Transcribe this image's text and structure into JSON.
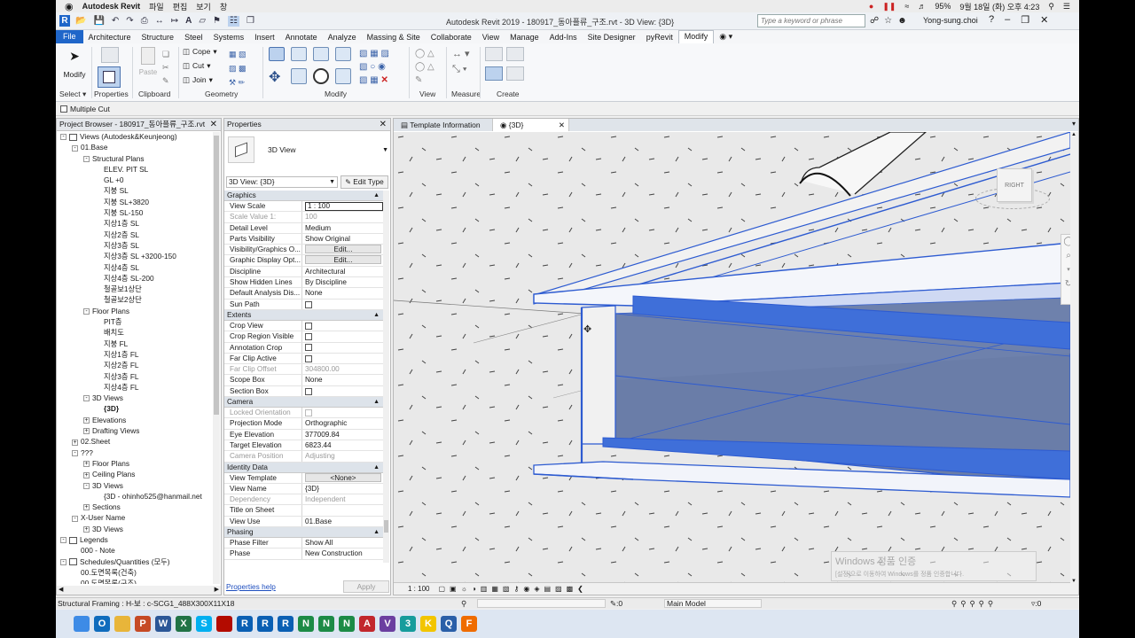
{
  "mac_menubar": {
    "app_name": "Autodesk Revit",
    "menus": [
      "파일",
      "편집",
      "보기",
      "창"
    ],
    "battery": "95%",
    "datetime": "9월 18일 (화) 오후 4:23"
  },
  "title_bar": {
    "title": "Autodesk Revit 2019 - 180917_동아플류_구조.rvt - 3D View: {3D}",
    "search_placeholder": "Type a keyword or phrase",
    "user": "Yong-sung.choi"
  },
  "ribbon_tabs": [
    "File",
    "Architecture",
    "Structure",
    "Steel",
    "Systems",
    "Insert",
    "Annotate",
    "Analyze",
    "Massing & Site",
    "Collaborate",
    "View",
    "Manage",
    "Add-Ins",
    "Site Designer",
    "pyRevit",
    "Modify"
  ],
  "ribbon_active_tab": "Modify",
  "ribbon_groups": {
    "select": "Select",
    "properties": "Properties",
    "clipboard": "Clipboard",
    "geometry": "Geometry",
    "modify": "Modify",
    "view": "View",
    "measure": "Measure",
    "create": "Create"
  },
  "ribbon_buttons": {
    "modify": "Modify",
    "paste": "Paste",
    "cope": "Cope",
    "cut": "Cut",
    "join": "Join"
  },
  "options_bar": {
    "multiple_cut": "Multiple Cut"
  },
  "project_browser": {
    "title": "Project Browser - 180917_동아플류_구조.rvt",
    "items": [
      {
        "label": "Views (Autodesk&Keunjeong)",
        "level": 0,
        "exp": "-"
      },
      {
        "label": "01.Base",
        "level": 1,
        "exp": "-"
      },
      {
        "label": "Structural Plans",
        "level": 2,
        "exp": "-"
      },
      {
        "label": "ELEV. PIT SL",
        "level": 3
      },
      {
        "label": "GL +0",
        "level": 3
      },
      {
        "label": "지붕 SL",
        "level": 3
      },
      {
        "label": "지붕 SL+3820",
        "level": 3
      },
      {
        "label": "지붕 SL-150",
        "level": 3
      },
      {
        "label": "지상1층 SL",
        "level": 3
      },
      {
        "label": "지상2층 SL",
        "level": 3
      },
      {
        "label": "지상3층 SL",
        "level": 3
      },
      {
        "label": "지상3층 SL +3200-150",
        "level": 3
      },
      {
        "label": "지상4층 SL",
        "level": 3
      },
      {
        "label": "지상4층 SL-200",
        "level": 3
      },
      {
        "label": "철골보1상단",
        "level": 3
      },
      {
        "label": "철골보2상단",
        "level": 3
      },
      {
        "label": "Floor Plans",
        "level": 2,
        "exp": "-"
      },
      {
        "label": "PIT층",
        "level": 3
      },
      {
        "label": "배치도",
        "level": 3
      },
      {
        "label": "지붕 FL",
        "level": 3
      },
      {
        "label": "지상1층 FL",
        "level": 3
      },
      {
        "label": "지상2층 FL",
        "level": 3
      },
      {
        "label": "지상3층 FL",
        "level": 3
      },
      {
        "label": "지상4층 FL",
        "level": 3
      },
      {
        "label": "3D Views",
        "level": 2,
        "exp": "-"
      },
      {
        "label": "{3D}",
        "level": 3,
        "bold": true
      },
      {
        "label": "Elevations",
        "level": 2,
        "exp": "+"
      },
      {
        "label": "Drafting Views",
        "level": 2,
        "exp": "+"
      },
      {
        "label": "02.Sheet",
        "level": 1,
        "exp": "+"
      },
      {
        "label": "???",
        "level": 1,
        "exp": "-"
      },
      {
        "label": "Floor Plans",
        "level": 2,
        "exp": "+"
      },
      {
        "label": "Ceiling Plans",
        "level": 2,
        "exp": "+"
      },
      {
        "label": "3D Views",
        "level": 2,
        "exp": "-"
      },
      {
        "label": "{3D - ohinho525@hanmail.net",
        "level": 3
      },
      {
        "label": "Sections",
        "level": 2,
        "exp": "+"
      },
      {
        "label": "X-User Name",
        "level": 1,
        "exp": "-"
      },
      {
        "label": "3D Views",
        "level": 2,
        "exp": "+"
      },
      {
        "label": "Legends",
        "level": 0,
        "exp": "-"
      },
      {
        "label": "000 - Note",
        "level": 1
      },
      {
        "label": "Schedules/Quantities (모두)",
        "level": 0,
        "exp": "-"
      },
      {
        "label": "00.도면목록(건축)",
        "level": 1
      },
      {
        "label": "00.도면목록(구조)",
        "level": 1
      }
    ]
  },
  "properties": {
    "title": "Properties",
    "type_name": "3D View",
    "selector": "3D View: {3D}",
    "edit_type": "Edit Type",
    "sections": [
      {
        "name": "Graphics",
        "rows": [
          {
            "k": "View Scale",
            "v": "1 : 100",
            "input": true
          },
          {
            "k": "Scale Value    1:",
            "v": "100",
            "dis": true
          },
          {
            "k": "Detail Level",
            "v": "Medium"
          },
          {
            "k": "Parts Visibility",
            "v": "Show Original"
          },
          {
            "k": "Visibility/Graphics O...",
            "v": "Edit...",
            "btn": true
          },
          {
            "k": "Graphic Display Opt...",
            "v": "Edit...",
            "btn": true
          },
          {
            "k": "Discipline",
            "v": "Architectural"
          },
          {
            "k": "Show Hidden Lines",
            "v": "By Discipline"
          },
          {
            "k": "Default Analysis Dis...",
            "v": "None"
          },
          {
            "k": "Sun Path",
            "v": "",
            "cb": true
          }
        ]
      },
      {
        "name": "Extents",
        "rows": [
          {
            "k": "Crop View",
            "v": "",
            "cb": true
          },
          {
            "k": "Crop Region Visible",
            "v": "",
            "cb": true
          },
          {
            "k": "Annotation Crop",
            "v": "",
            "cb": true
          },
          {
            "k": "Far Clip Active",
            "v": "",
            "cb": true
          },
          {
            "k": "Far Clip Offset",
            "v": "304800.00",
            "dis": true
          },
          {
            "k": "Scope Box",
            "v": "None"
          },
          {
            "k": "Section Box",
            "v": "",
            "cb": true
          }
        ]
      },
      {
        "name": "Camera",
        "rows": [
          {
            "k": "Locked Orientation",
            "v": "",
            "cb": true,
            "dis": true
          },
          {
            "k": "Projection Mode",
            "v": "Orthographic"
          },
          {
            "k": "Eye Elevation",
            "v": "377009.84"
          },
          {
            "k": "Target Elevation",
            "v": "6823.44"
          },
          {
            "k": "Camera Position",
            "v": "Adjusting",
            "dis": true
          }
        ]
      },
      {
        "name": "Identity Data",
        "rows": [
          {
            "k": "View Template",
            "v": "<None>",
            "btn": true
          },
          {
            "k": "View Name",
            "v": "{3D}"
          },
          {
            "k": "Dependency",
            "v": "Independent",
            "dis": true
          },
          {
            "k": "Title on Sheet",
            "v": ""
          },
          {
            "k": "View Use",
            "v": "01.Base"
          }
        ]
      },
      {
        "name": "Phasing",
        "rows": [
          {
            "k": "Phase Filter",
            "v": "Show All"
          },
          {
            "k": "Phase",
            "v": "New Construction"
          }
        ]
      }
    ],
    "help": "Properties help",
    "apply": "Apply"
  },
  "view_tabs": [
    {
      "label": "Template Information",
      "active": false
    },
    {
      "label": "{3D}",
      "active": true
    }
  ],
  "viewcube": {
    "face_right": "RIGHT"
  },
  "watermark": {
    "line1": "Windows 정품 인증",
    "line2": "[설정]으로 이동하여 Windows를 정품 인증합니다."
  },
  "view_control_bar": {
    "scale": "1 : 100"
  },
  "status_bar": {
    "left": "Structural Framing : H-보 : c-SCG1_488X300X11X18",
    "zero": ":0",
    "model": "Main Model"
  },
  "taskbar_apps": [
    {
      "n": "finder",
      "c": "#3d8be6",
      "t": ""
    },
    {
      "n": "outlook",
      "c": "#0f6cbd",
      "t": "O"
    },
    {
      "n": "chrome",
      "c": "#e8b53a",
      "t": ""
    },
    {
      "n": "powerpoint",
      "c": "#c64a25",
      "t": "P"
    },
    {
      "n": "word",
      "c": "#2b5797",
      "t": "W"
    },
    {
      "n": "excel",
      "c": "#217346",
      "t": "X"
    },
    {
      "n": "skype",
      "c": "#00aff0",
      "t": "S"
    },
    {
      "n": "acrobat",
      "c": "#b30b00",
      "t": ""
    },
    {
      "n": "revit-a",
      "c": "#0a5fb3",
      "t": "R"
    },
    {
      "n": "revit-b",
      "c": "#0a5fb3",
      "t": "R"
    },
    {
      "n": "revit-c",
      "c": "#0a5fb3",
      "t": "R"
    },
    {
      "n": "navis-a",
      "c": "#1c8b46",
      "t": "N"
    },
    {
      "n": "navis-b",
      "c": "#1c8b46",
      "t": "N"
    },
    {
      "n": "navis-c",
      "c": "#1c8b46",
      "t": "N"
    },
    {
      "n": "autocad",
      "c": "#c2272d",
      "t": "A"
    },
    {
      "n": "vault",
      "c": "#6b3fa0",
      "t": "V"
    },
    {
      "n": "max",
      "c": "#169c9c",
      "t": "3"
    },
    {
      "n": "kakao",
      "c": "#f2c500",
      "t": "K"
    },
    {
      "n": "quicktime",
      "c": "#2a5fa8",
      "t": "Q"
    },
    {
      "n": "fusion",
      "c": "#ef6c00",
      "t": "F"
    }
  ],
  "colors": {
    "accent": "#1f66c9",
    "steel_blue": "#3f6fd9",
    "ribbon_bg": "#f7f8fa",
    "viewport_bg": "#e9e9e9"
  }
}
